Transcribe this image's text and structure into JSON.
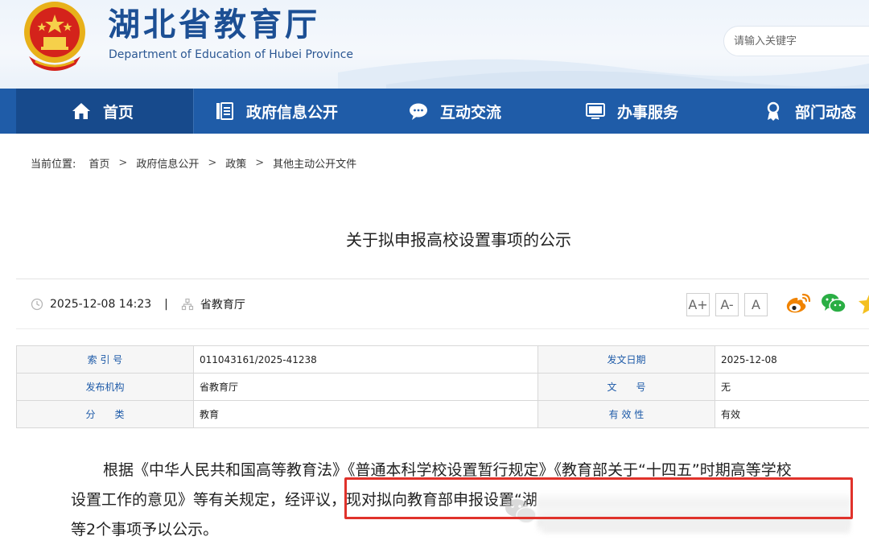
{
  "header": {
    "site_title": "湖北省教育厅",
    "site_subtitle": "Department of Education of Hubei Province",
    "search_placeholder": "请输入关键字"
  },
  "nav": {
    "items": [
      {
        "label": "首页",
        "icon": "home-icon"
      },
      {
        "label": "政府信息公开",
        "icon": "document-list-icon"
      },
      {
        "label": "互动交流",
        "icon": "chat-bubble-icon"
      },
      {
        "label": "办事服务",
        "icon": "monitor-icon"
      },
      {
        "label": "部门动态",
        "icon": "user-badge-icon"
      }
    ],
    "active_index": 0
  },
  "breadcrumb": {
    "label": "当前位置:",
    "items": [
      "首页",
      "政府信息公开",
      "政策",
      "其他主动公开文件"
    ],
    "separator": ">"
  },
  "article": {
    "title": "关于拟申报高校设置事项的公示",
    "datetime": "2025-12-08 14:23",
    "divider": "|",
    "source": "省教育厅",
    "font_buttons": [
      "A+",
      "A-",
      "A"
    ]
  },
  "share": {
    "icons": [
      "weibo-icon",
      "wechat-icon",
      "star-icon"
    ]
  },
  "info": {
    "rows": [
      {
        "k1": "索 引 号",
        "v1": "011043161/2025-41238",
        "k2": "发文日期",
        "v2": "2025-12-08"
      },
      {
        "k1": "发布机构",
        "v1": "省教育厅",
        "k2": "文　　号",
        "v2": "无"
      },
      {
        "k1": "分　　类",
        "v1": "教育",
        "k2": "有 效 性",
        "v2": "有效"
      }
    ]
  },
  "body": {
    "line1": "根据《中华人民共和国高等教育法》《普通本科学校设置暂行规定》《教育部关于“十四五”时期高等学校",
    "line2": "设置工作的意见》等有关规定，经评议，现对拟向教育部申报设置“湖",
    "line3": "等2个事项予以公示。"
  },
  "colors": {
    "brand_blue": "#1f5ca8",
    "nav_active": "#174a8c",
    "title_blue": "#1c4f94",
    "highlight_red": "#e0322b",
    "weibo_orange": "#f08300",
    "wechat_green": "#2aae44"
  }
}
